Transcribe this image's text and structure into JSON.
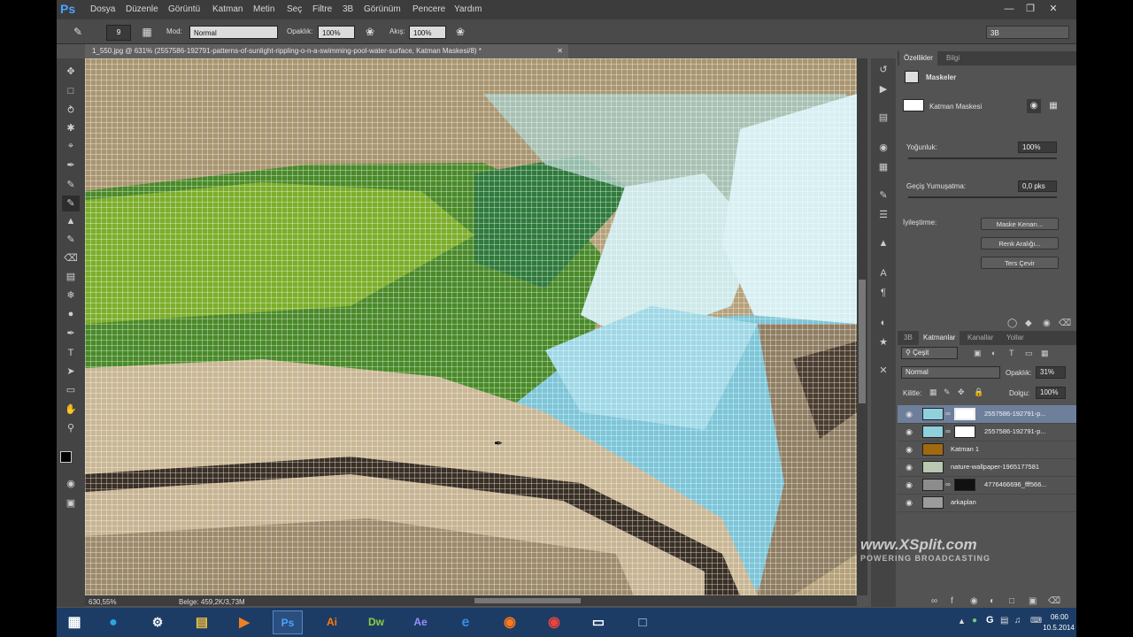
{
  "menubar": {
    "logo": "Ps",
    "items": [
      "Dosya",
      "Düzenle",
      "Görüntü",
      "Katman",
      "Metin",
      "Seç",
      "Filtre",
      "3B",
      "Görünüm",
      "Pencere",
      "Yardım"
    ]
  },
  "options": {
    "brush_size": "9",
    "mode_label": "Mod:",
    "mode_value": "Normal",
    "opacity_label": "Opaklık:",
    "opacity_value": "100%",
    "flow_label": "Akış:",
    "flow_value": "100%",
    "workspace_value": "3B"
  },
  "document": {
    "tab_title": "1_550.jpg @ 631% (2557586-192791-patterns-of-sunlight-rippling-o-n-a-swimming-pool-water-surface, Katman Maskesi/8) *",
    "zoom": "630,55%",
    "doc_info": "Belge: 459,2K/3,73M"
  },
  "properties": {
    "tabs": [
      "Özellikler",
      "Bilgi"
    ],
    "section": "Maskeler",
    "mask_type": "Katman Maskesi",
    "density_label": "Yoğunluk:",
    "density_value": "100%",
    "feather_label": "Geçiş Yumuşatma:",
    "feather_value": "0,0 pks",
    "refine_label": "İyileştirme:",
    "buttons": [
      "Maske Kenarı...",
      "Renk Aralığı...",
      "Ters Çevir"
    ]
  },
  "layers_panel": {
    "tabs": [
      "3B",
      "Katmanlar",
      "Kanallar",
      "Yollar"
    ],
    "filter_kind": "Çeşit",
    "blend_mode": "Normal",
    "opacity_label": "Opaklık:",
    "opacity_value": "31%",
    "lock_label": "Kilitle:",
    "fill_label": "Dolgu:",
    "fill_value": "100%",
    "layers": [
      {
        "name": "2557586-192791-p...",
        "selected": true
      },
      {
        "name": "2557586-192791-p...",
        "selected": false
      },
      {
        "name": "Katman 1",
        "selected": false
      },
      {
        "name": "nature-wallpaper-1965177581",
        "selected": false
      },
      {
        "name": "4776466696_fff566...",
        "selected": false
      },
      {
        "name": "arkaplan",
        "selected": false
      }
    ]
  },
  "watermark": {
    "brand": "www.XSplit.com",
    "tagline": "POWERING BROADCASTING"
  },
  "taskbar": {
    "apps": [
      "Ps",
      "Ai",
      "Dw",
      "Ae"
    ],
    "time": "06:00",
    "date": "10.5.2014"
  },
  "colors": {
    "accent": "#4aa3ff",
    "panel": "#535353",
    "selected_layer": "#6e7f9c",
    "taskbar": "#1c3c66"
  }
}
